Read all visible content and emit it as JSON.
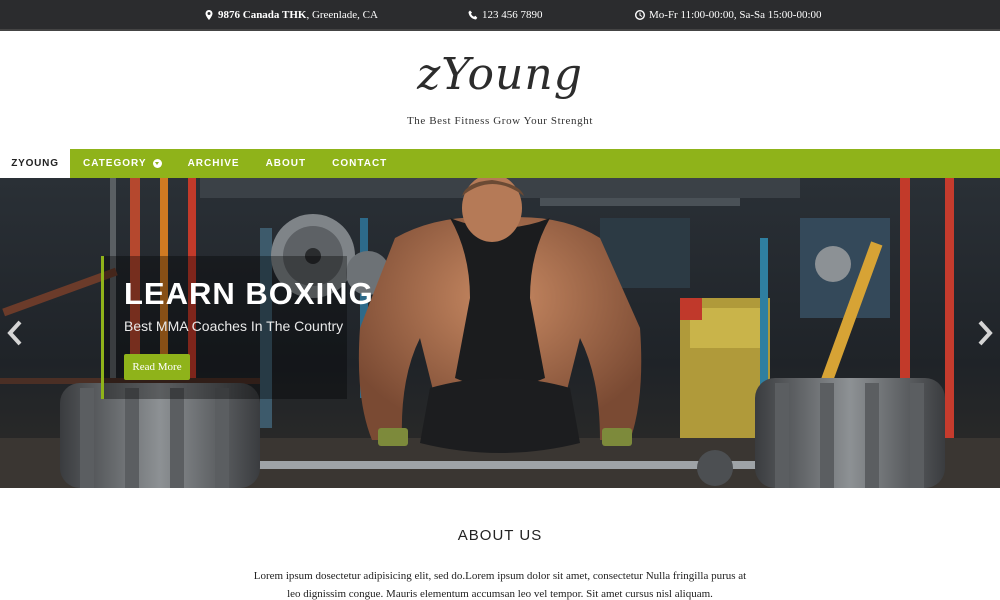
{
  "topbar": {
    "address_bold": "9876 Canada THK",
    "address_rest": ", Greenlade, CA",
    "phone": "123 456 7890",
    "hours": "Mo-Fr 11:00-00:00, Sa-Sa 15:00-00:00"
  },
  "brand": {
    "logo": "zYoung",
    "tagline": "The Best Fitness Grow Your Strenght"
  },
  "nav": {
    "home": "ZYOUNG",
    "items": [
      "CATEGORY",
      "ARCHIVE",
      "ABOUT",
      "CONTACT"
    ]
  },
  "hero": {
    "title": "LEARN BOXING",
    "subtitle": "Best MMA Coaches In The Country",
    "button": "Read More"
  },
  "about": {
    "title": "ABOUT US",
    "text": "Lorem ipsum dosectetur adipisicing elit, sed do.Lorem ipsum dolor sit amet, consectetur Nulla fringilla purus at leo dignissim congue. Mauris elementum accumsan leo vel tempor. Sit amet cursus nisl aliquam."
  },
  "colors": {
    "accent": "#8fb31a",
    "topbar": "#2b2c2e"
  },
  "icons": [
    "map-marker-icon",
    "phone-icon",
    "clock-icon",
    "chevron-left-icon",
    "chevron-right-icon",
    "chevron-down-icon"
  ]
}
